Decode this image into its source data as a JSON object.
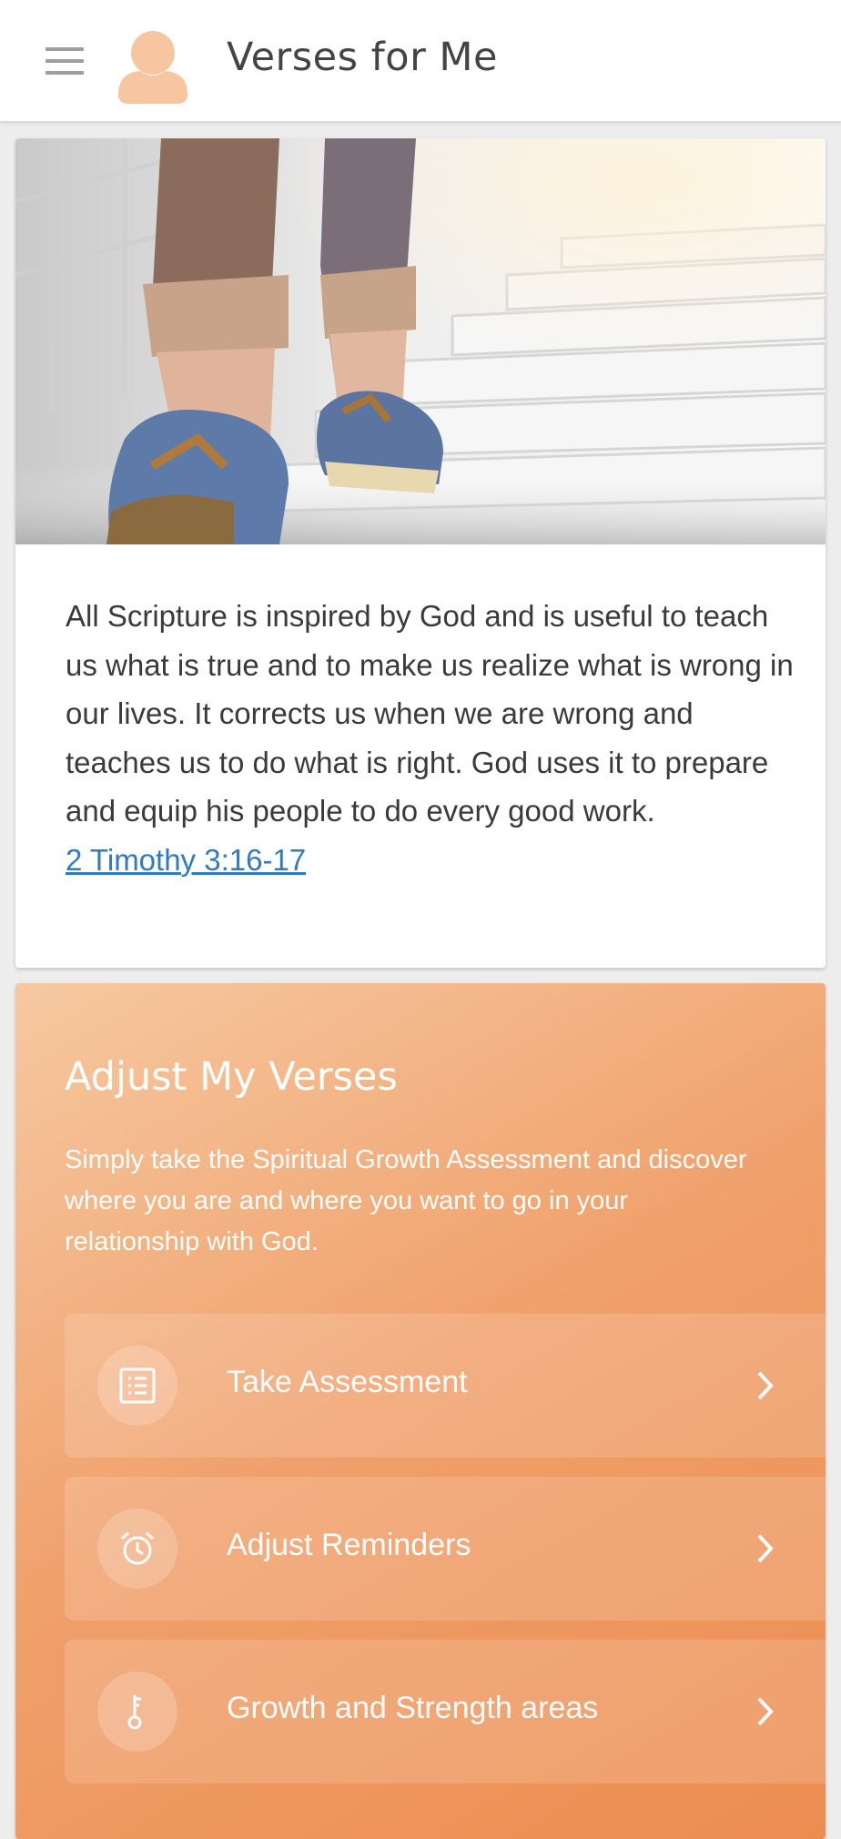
{
  "app_bar": {
    "title": "Verses for Me",
    "menu_icon": "hamburger-menu-icon",
    "avatar_icon": "user-avatar-icon"
  },
  "verse_card": {
    "image": "person-walking-up-stairs-photo",
    "text": "All Scripture is inspired by God and is useful to teach us what is true and to make us realize what is wrong in our lives. It corrects us when we are wrong and teaches us to do what is right. God uses it to prepare and equip his people to do every good work.",
    "reference": "2 Timothy 3:16-17"
  },
  "adjust_card": {
    "title": "Adjust My Verses",
    "description": "Simply take the Spiritual Growth Assessment and discover where you are and where you want to go in your relationship with God.",
    "actions": [
      {
        "label": "Take Assessment",
        "icon": "checklist-icon"
      },
      {
        "label": "Adjust Reminders",
        "icon": "alarm-clock-icon"
      },
      {
        "label": "Growth and Strength areas",
        "icon": "key-icon"
      }
    ]
  },
  "colors": {
    "accent_orange": "#ec8d50",
    "link_blue": "#2f7bc0",
    "title_gray": "#444444"
  }
}
